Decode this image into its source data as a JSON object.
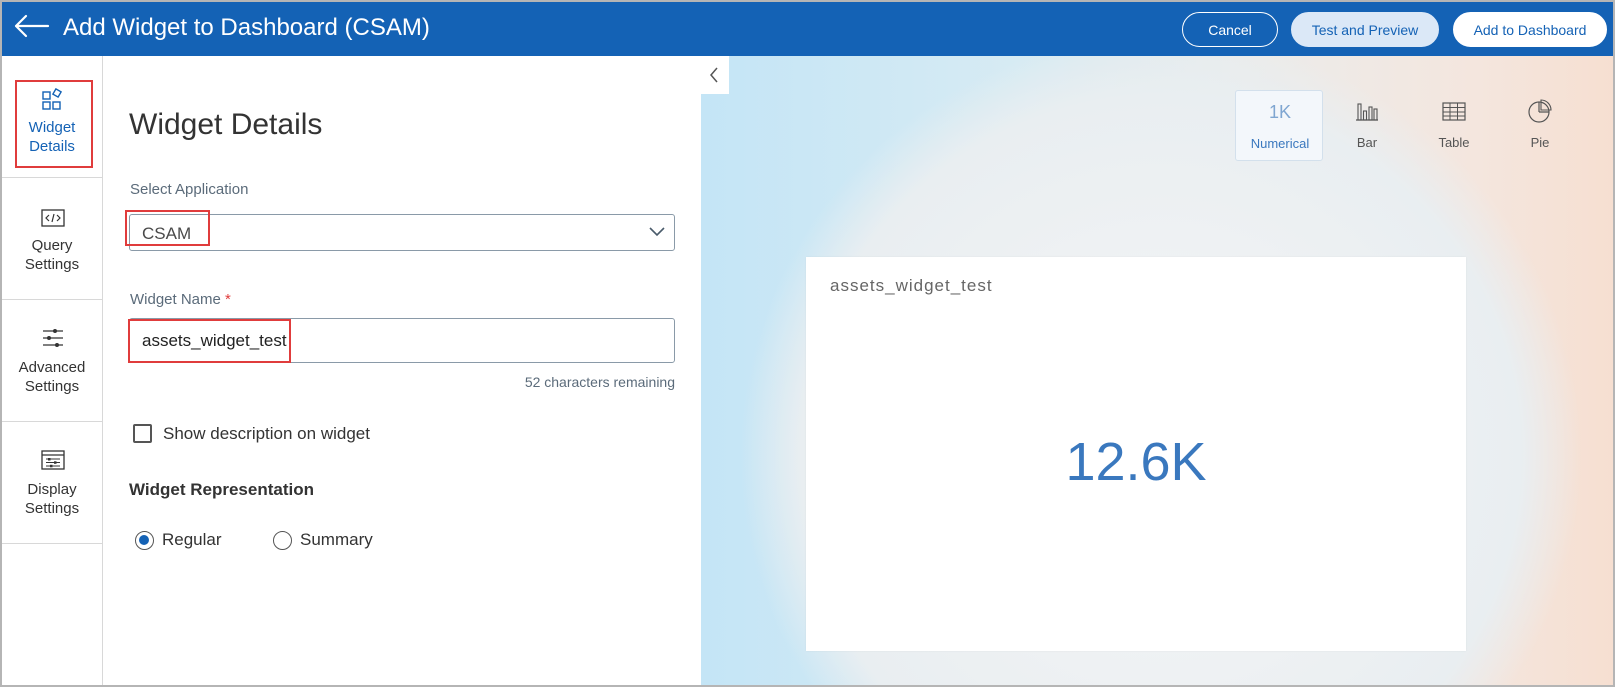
{
  "header": {
    "title": "Add Widget to Dashboard (CSAM)",
    "cancel_label": "Cancel",
    "test_preview_label": "Test and Preview",
    "add_label": "Add to Dashboard",
    "bg_color": "#1462b5"
  },
  "leftnav": {
    "items": [
      {
        "label_line1": "Widget",
        "label_line2": "Details",
        "icon": "widget-details-icon",
        "active": true
      },
      {
        "label_line1": "Query",
        "label_line2": "Settings",
        "icon": "code-icon",
        "active": false
      },
      {
        "label_line1": "Advanced",
        "label_line2": "Settings",
        "icon": "sliders-icon",
        "active": false
      },
      {
        "label_line1": "Display",
        "label_line2": "Settings",
        "icon": "display-settings-icon",
        "active": false
      }
    ]
  },
  "form": {
    "heading": "Widget Details",
    "application_label": "Select Application",
    "application_value": "CSAM",
    "widget_name_label": "Widget Name",
    "required_marker": "*",
    "widget_name_value": "assets_widget_test",
    "characters_remaining": "52 characters remaining",
    "show_description_label": "Show description on widget",
    "show_description_checked": false,
    "representation_heading": "Widget Representation",
    "representation_options": [
      {
        "label": "Regular",
        "checked": true
      },
      {
        "label": "Summary",
        "checked": false
      }
    ]
  },
  "preview": {
    "chart_types": [
      {
        "label": "Numerical",
        "glyph": "1K",
        "icon": "numerical-icon",
        "active": true
      },
      {
        "label": "Bar",
        "icon": "bar-chart-icon",
        "active": false
      },
      {
        "label": "Table",
        "icon": "table-icon",
        "active": false
      },
      {
        "label": "Pie",
        "icon": "pie-chart-icon",
        "active": false
      }
    ],
    "card_title": "assets_widget_test",
    "card_value": "12.6K",
    "accent_color": "#3a78be"
  }
}
